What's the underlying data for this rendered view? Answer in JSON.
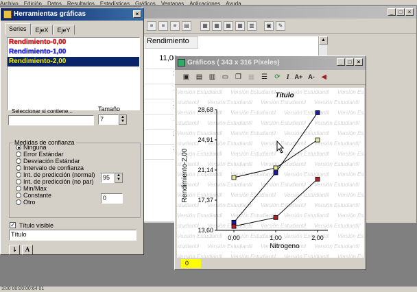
{
  "menubar": [
    "Archivo",
    "Edición",
    "Datos",
    "Resultados",
    "Estadísticas",
    "Gráficos",
    "Ventanas",
    "Aplicaciones",
    "Ayuda"
  ],
  "background_grid": {
    "column_header": "Rendimiento",
    "values": [
      "11,00",
      "2",
      "1",
      "2",
      "1",
      "2",
      "3"
    ]
  },
  "status_text": "3:00 00:00:00:64 01",
  "tools_window": {
    "title": "Herramientas gráficas",
    "tabs": [
      "Series",
      "EjeX",
      "EjeY"
    ],
    "series": [
      "Rendimiento-0,00",
      "Rendimiento-1,00",
      "Rendimiento-2,00"
    ],
    "contains_label": "Seleccionar si contiene...",
    "contains_value": "",
    "size_label": "Tamaño",
    "size_value": "7",
    "confidence_title": "Medidas de confianza",
    "options": [
      "Ninguna",
      "Error Estándar",
      "Desviación Estándar",
      "Intervalo de confianza",
      "Int. de predicción (normal)",
      "Int. de predicción (no par)",
      "Min/Max",
      "Constante",
      "Otro"
    ],
    "selected_option": "Ninguna",
    "level_value": "95",
    "constant_value": "0",
    "title_visible_label": "Título visible",
    "title_value": "Título",
    "title_visible_checked": true
  },
  "graph_window": {
    "title": "Gráficos ( 343 x 316 Píxeles)",
    "toolbar_text": [
      "I",
      "A+",
      "A-"
    ],
    "watermark": "Versión Estudiantil",
    "status_value": "0"
  },
  "chart_data": {
    "type": "line",
    "title": "Título",
    "xlabel": "Nitrogeno",
    "ylabel": "Rendimiento-2,00",
    "x": [
      "0,00",
      "1,00",
      "2,00"
    ],
    "x_values": [
      0,
      1,
      2
    ],
    "ylim": [
      13.6,
      28.68
    ],
    "yticks": [
      "13,60",
      "17,37",
      "21,14",
      "24,91",
      "28,68"
    ],
    "ytick_values": [
      13.6,
      17.37,
      21.14,
      24.91,
      28.68
    ],
    "series": [
      {
        "name": "Rendimiento-0,00",
        "color": "#1a1aa8",
        "values": [
          14.6,
          20.8,
          28.3
        ]
      },
      {
        "name": "Rendimiento-1,00",
        "color": "#b0202a",
        "values": [
          14.1,
          15.2,
          20.0
        ]
      },
      {
        "name": "Rendimiento-2,00",
        "color": "#e8e8a0",
        "values": [
          20.2,
          21.4,
          24.9
        ]
      }
    ],
    "grid": false
  },
  "colors": {
    "titlebar_active": "#0a246a",
    "titlebar_inactive": "#8c8c8c",
    "status_highlight": "#ffff00"
  }
}
